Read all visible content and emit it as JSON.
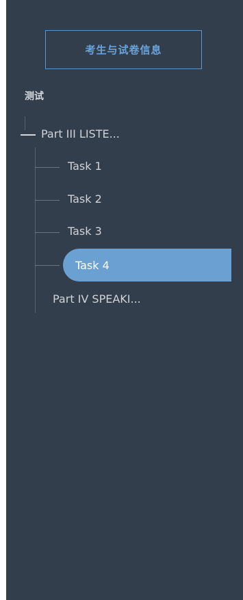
{
  "header": {
    "info_button_label": "考生与试卷信息"
  },
  "tree": {
    "title": "测试",
    "part3_label": "Part III LISTE...",
    "tasks": [
      {
        "label": "Task 1"
      },
      {
        "label": "Task 2"
      },
      {
        "label": "Task 3"
      },
      {
        "label": "Task 4"
      }
    ],
    "part4_label": "Part IV SPEAKI..."
  },
  "colors": {
    "panel_bg": "#333e4c",
    "accent": "#6aa0d2",
    "text": "#cfd3d9"
  }
}
